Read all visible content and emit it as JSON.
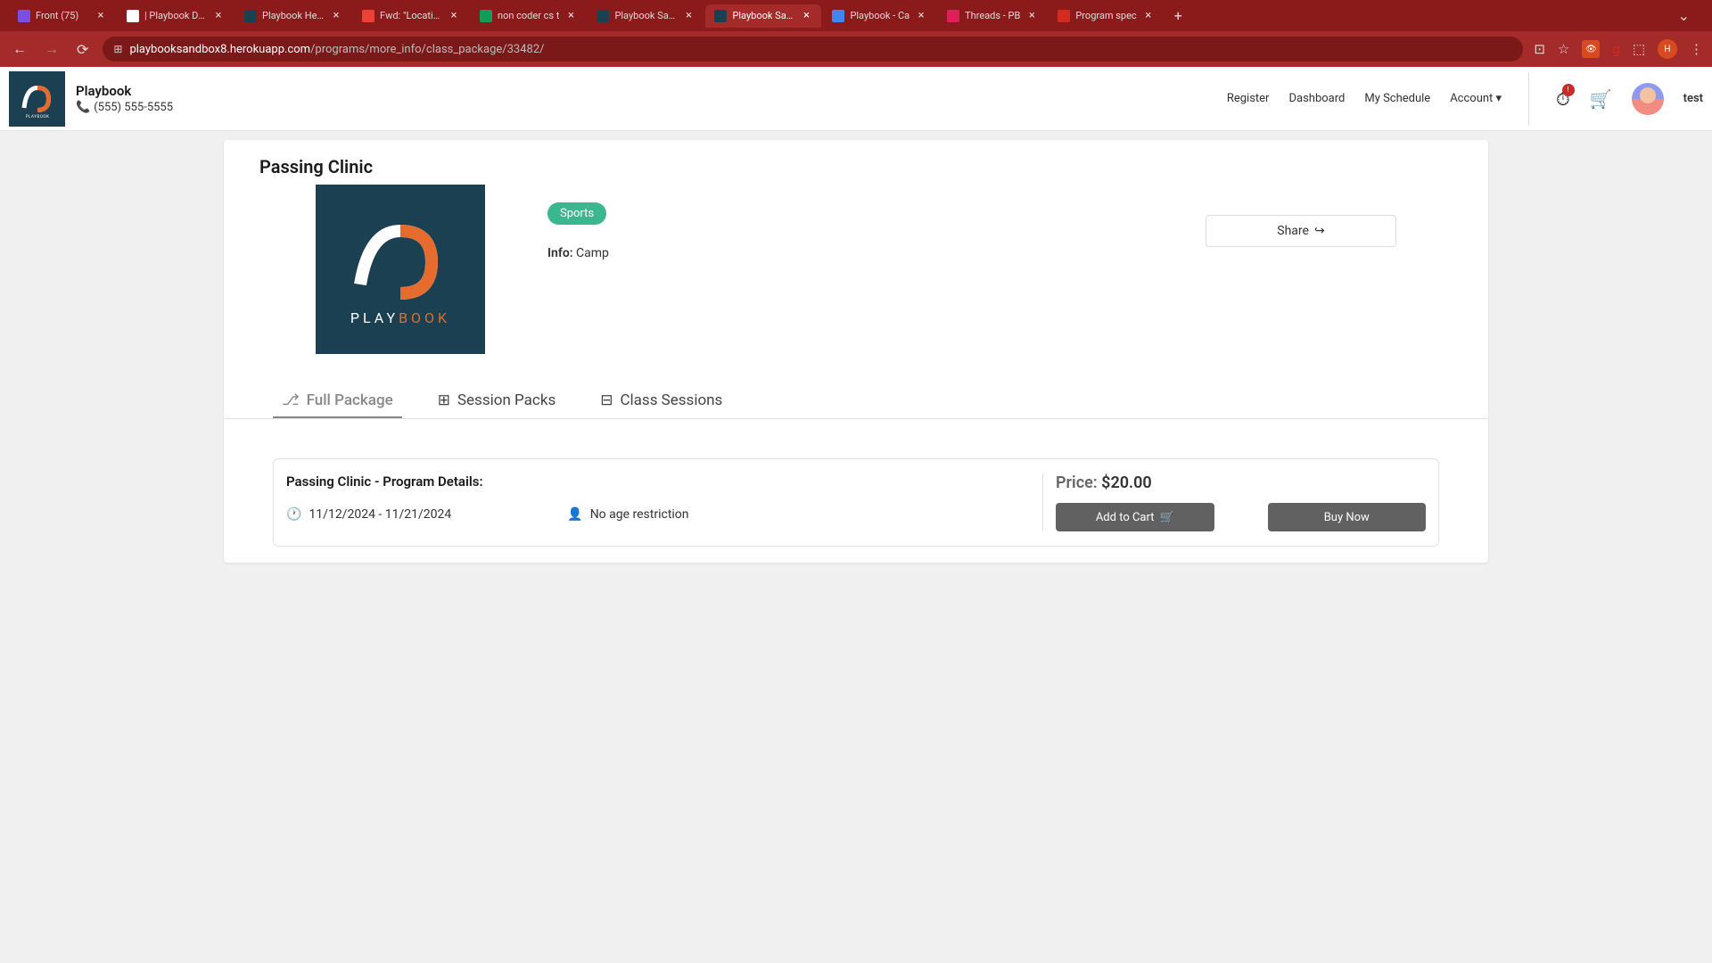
{
  "browser": {
    "tabs": [
      {
        "title": "Front (75)",
        "favicon": "#7B4FE6",
        "active": false
      },
      {
        "title": "| Playbook Das",
        "favicon": "#fff",
        "active": false
      },
      {
        "title": "Playbook Help",
        "favicon": "#1a4052",
        "active": false
      },
      {
        "title": "Fwd: \"Location",
        "favicon": "#EA4335",
        "active": false
      },
      {
        "title": "non coder cs t",
        "favicon": "#0F9D58",
        "active": false
      },
      {
        "title": "Playbook Sanc",
        "favicon": "#1a4052",
        "active": false
      },
      {
        "title": "Playbook Sanc",
        "favicon": "#1a4052",
        "active": true
      },
      {
        "title": "Playbook - Ca",
        "favicon": "#4285F4",
        "active": false
      },
      {
        "title": "Threads - PB",
        "favicon": "#E01E5A",
        "active": false
      },
      {
        "title": "Program spec",
        "favicon": "#D42B1E",
        "active": false
      }
    ],
    "url_host": "playbooksandbox8.herokuapp.com",
    "url_path": "/programs/more_info/class_package/33482/"
  },
  "header": {
    "org_name": "Playbook",
    "phone": "(555) 555-5555",
    "nav": {
      "register": "Register",
      "dashboard": "Dashboard",
      "schedule": "My Schedule",
      "account": "Account"
    },
    "notification_badge": "!",
    "username": "test"
  },
  "page": {
    "title": "Passing Clinic",
    "logo_text": "PLAYBOOK",
    "category": "Sports",
    "info_label": "Info:",
    "info_value": "Camp",
    "share_label": "Share",
    "tabs": {
      "full_package": "Full Package",
      "session_packs": "Session Packs",
      "class_sessions": "Class Sessions"
    },
    "details": {
      "title": "Passing Clinic - Program Details:",
      "dates": "11/12/2024 - 11/21/2024",
      "age": "No age restriction",
      "price_label": "Price: ",
      "price_value": "$20.00",
      "add_to_cart": "Add to Cart",
      "buy_now": "Buy Now"
    }
  }
}
